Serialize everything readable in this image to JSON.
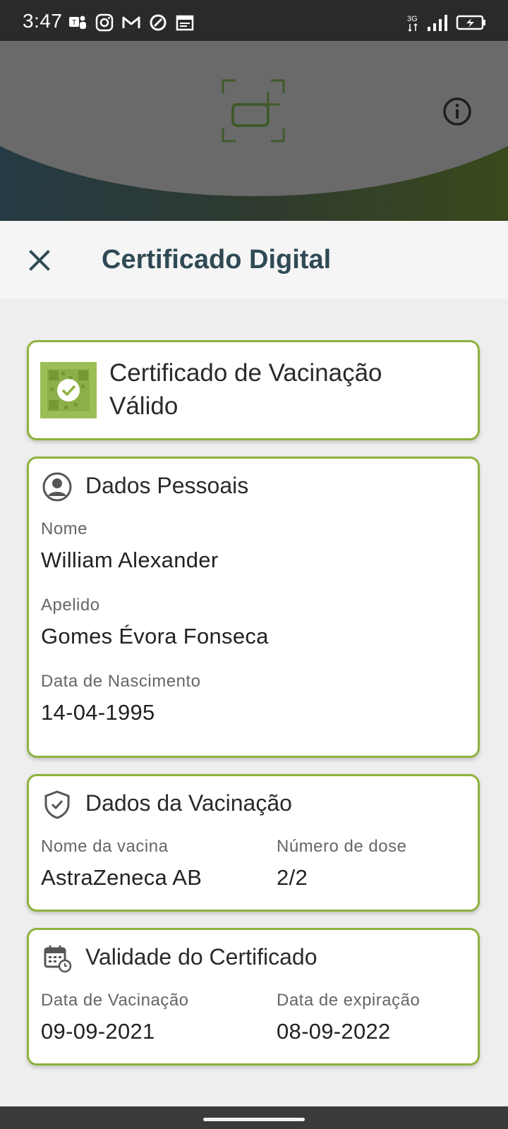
{
  "status_bar": {
    "time": "3:47",
    "left_icons": [
      "teams-icon",
      "instagram-icon",
      "gmail-icon",
      "at-icon",
      "calendar-icon"
    ],
    "network": "3G",
    "battery": "charging"
  },
  "hero": {
    "logo_icon": "scan-logo-icon",
    "info_icon": "info-icon"
  },
  "sheet": {
    "title": "Certificado Digital",
    "close_icon": "close-icon"
  },
  "status_card": {
    "title_line1": "Certificado de Vacinação",
    "title_line2": "Válido",
    "accent_color": "#8db13d"
  },
  "personal": {
    "title": "Dados Pessoais",
    "name_label": "Nome",
    "name_value": "William Alexander",
    "surname_label": "Apelido",
    "surname_value": "Gomes Évora Fonseca",
    "dob_label": "Data de Nascimento",
    "dob_value": "14-04-1995"
  },
  "vaccination": {
    "title": "Dados da Vacinação",
    "vaccine_label": "Nome da vacina",
    "vaccine_value": "AstraZeneca AB",
    "dose_label": "Número de dose",
    "dose_value": "2/2"
  },
  "validity": {
    "title": "Validade do Certificado",
    "vacc_date_label": "Data de Vacinação",
    "vacc_date_value": "09-09-2021",
    "exp_date_label": "Data de expiração",
    "exp_date_value": "08-09-2022"
  }
}
